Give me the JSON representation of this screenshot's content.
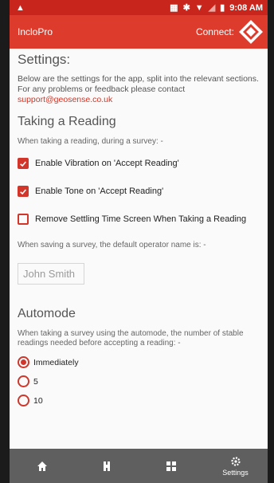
{
  "status_bar": {
    "time": "9:08 AM"
  },
  "app_bar": {
    "title": "IncloPro",
    "connect_label": "Connect:"
  },
  "settings": {
    "title": "Settings:",
    "intro": "Below are the settings for the app, split into the relevant sections. For any problems or feedback please contact",
    "support_email": "support@geosense.co.uk"
  },
  "reading": {
    "title": "Taking a Reading",
    "hint": "When taking a reading, during a survey: -",
    "options": [
      {
        "label": "Enable Vibration on 'Accept Reading'",
        "checked": true
      },
      {
        "label": "Enable Tone on 'Accept Reading'",
        "checked": true
      },
      {
        "label": "Remove Settling Time Screen When Taking a Reading",
        "checked": false
      }
    ],
    "operator_hint": "When saving a survey, the default operator name is: -",
    "operator_name": "John Smith"
  },
  "automode": {
    "title": "Automode",
    "hint": "When taking a survey using the automode, the number of stable readings needed before accepting a reading: -",
    "options": [
      {
        "label": "Immediately",
        "selected": true
      },
      {
        "label": "5",
        "selected": false
      },
      {
        "label": "10",
        "selected": false
      }
    ]
  },
  "bottom_nav": {
    "settings_label": "Settings"
  },
  "colors": {
    "status_bar": "#c8261d",
    "app_bar": "#dd3b2c",
    "accent": "#d2362a",
    "nav_bar": "#5f5f5f"
  }
}
